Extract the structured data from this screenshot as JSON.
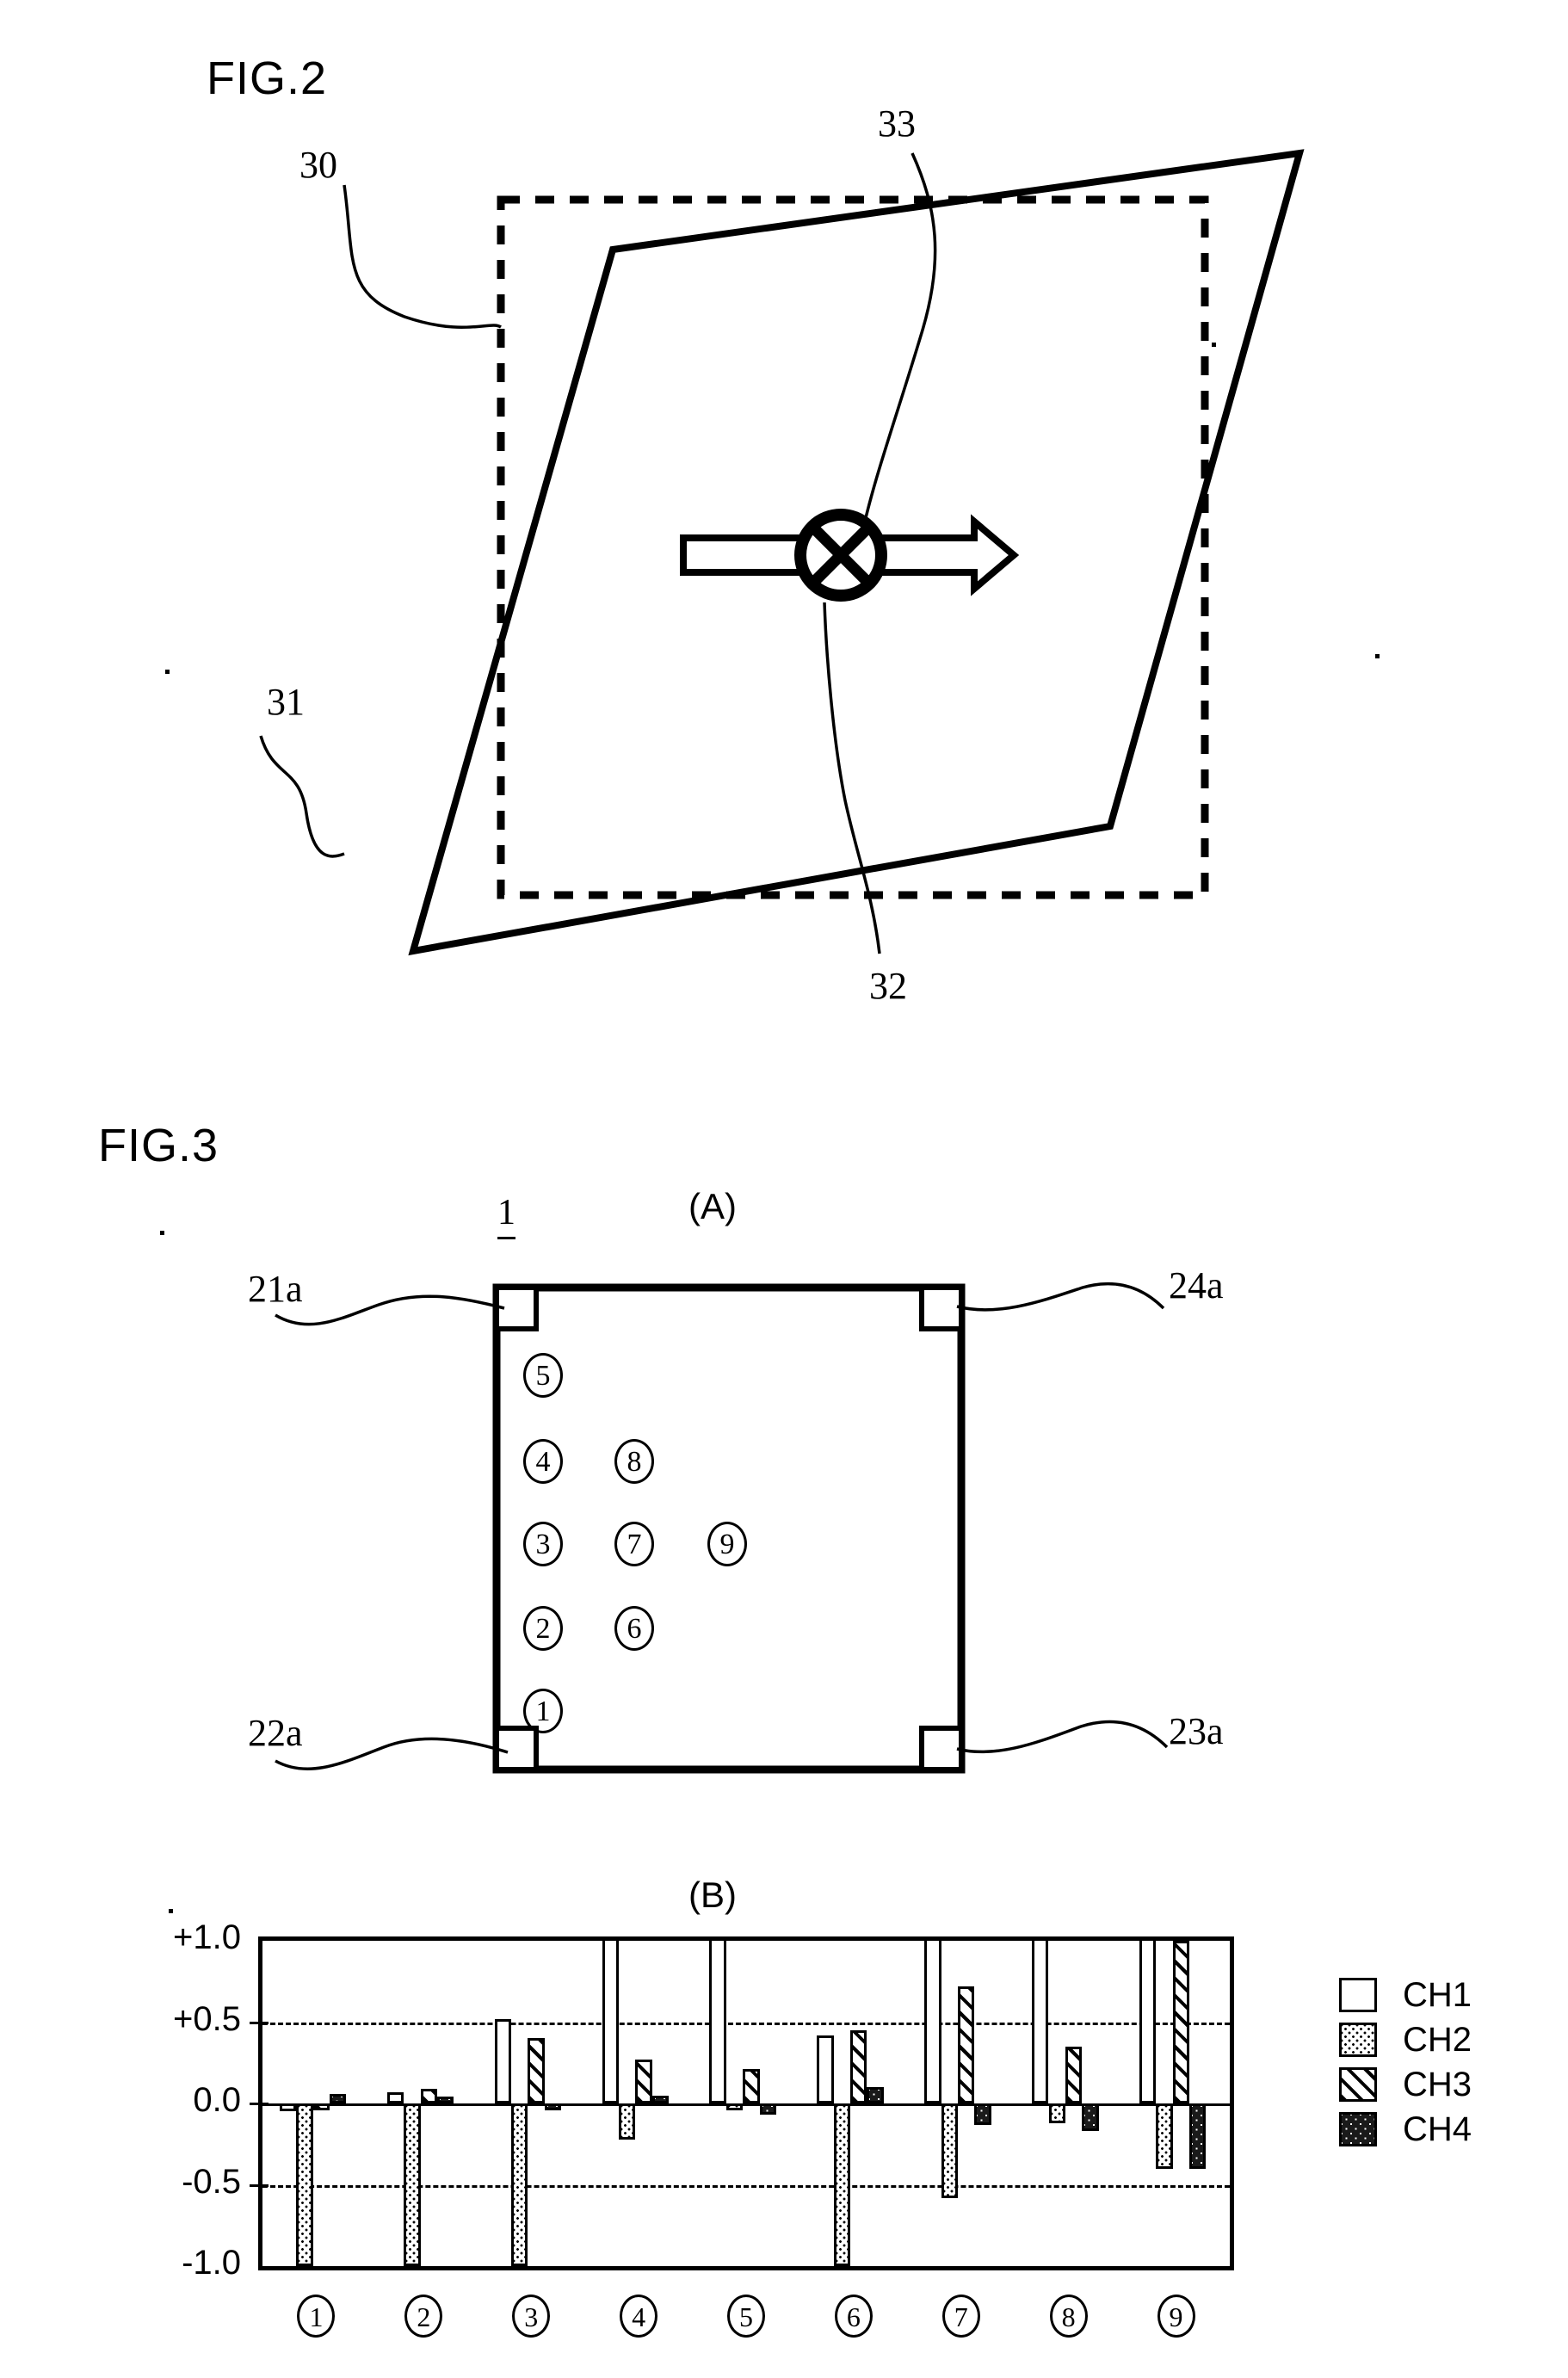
{
  "figures": [
    {
      "id": "fig2",
      "label": "FIG.2",
      "refs": [
        {
          "name": "30",
          "text": "30"
        },
        {
          "name": "31",
          "text": "31"
        },
        {
          "name": "32",
          "text": "32"
        },
        {
          "name": "33",
          "text": "33"
        }
      ],
      "symbol": "crossed-circle-with-double-headed-arrow"
    },
    {
      "id": "fig3",
      "label": "FIG.3",
      "panel_a": {
        "letter": "(A)",
        "device_ref": "1",
        "corner_refs": [
          {
            "name": "21a",
            "text": "21a"
          },
          {
            "name": "24a",
            "text": "24a"
          },
          {
            "name": "22a",
            "text": "22a"
          },
          {
            "name": "23a",
            "text": "23a"
          }
        ],
        "measurement_points": [
          "1",
          "2",
          "3",
          "4",
          "5",
          "6",
          "7",
          "8",
          "9"
        ]
      },
      "panel_b": {
        "letter": "(B)"
      }
    }
  ],
  "chart_data": {
    "type": "bar",
    "title": "(B)",
    "xlabel": "",
    "ylabel": "",
    "ylim": [
      -1.0,
      1.0
    ],
    "yticks": [
      "+1.0",
      "+0.5",
      "0.0",
      "-0.5",
      "-1.0"
    ],
    "ytick_values": [
      1.0,
      0.5,
      0.0,
      -0.5,
      -1.0
    ],
    "gridlines_dashed_at": [
      0.5,
      -0.5
    ],
    "zero_line": 0.0,
    "grid": true,
    "legend_position": "right",
    "categories": [
      "1",
      "2",
      "3",
      "4",
      "5",
      "6",
      "7",
      "8",
      "9"
    ],
    "series": [
      {
        "name": "CH1",
        "pattern": "empty",
        "values": [
          -0.05,
          0.07,
          0.52,
          1.12,
          1.12,
          0.42,
          1.12,
          1.12,
          1.12
        ]
      },
      {
        "name": "CH2",
        "pattern": "dotted",
        "values": [
          -1.0,
          -1.0,
          -1.0,
          -0.22,
          -0.03,
          -1.0,
          -0.58,
          -0.12,
          -0.4
        ]
      },
      {
        "name": "CH3",
        "pattern": "hatched",
        "values": [
          -0.04,
          0.09,
          0.4,
          0.27,
          0.21,
          0.45,
          0.72,
          0.35,
          1.0
        ]
      },
      {
        "name": "CH4",
        "pattern": "solid",
        "values": [
          0.06,
          0.04,
          -0.03,
          0.05,
          -0.07,
          0.1,
          -0.13,
          -0.17,
          -0.4
        ]
      }
    ],
    "legend_entries": [
      "CH1",
      "CH2",
      "CH3",
      "CH4"
    ]
  }
}
